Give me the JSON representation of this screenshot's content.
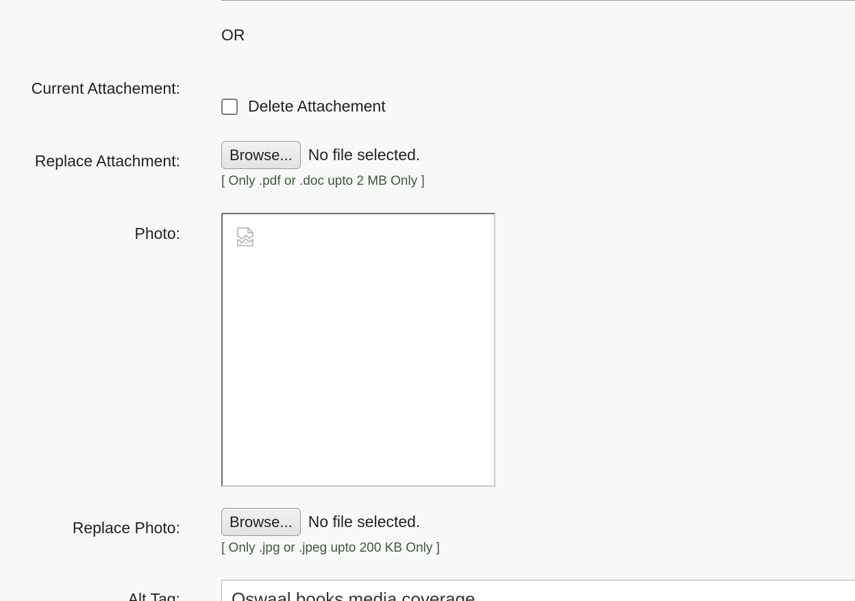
{
  "or_text": "OR",
  "current_attachment": {
    "label": "Current Attachement:",
    "delete_checkbox_label": "Delete Attachement",
    "delete_checked": false
  },
  "replace_attachment": {
    "label": "Replace Attachment:",
    "button_label": "Browse...",
    "file_status": "No file selected.",
    "hint": "[ Only .pdf or .doc upto 2 MB Only ]"
  },
  "photo": {
    "label": "Photo:",
    "preview_icon": "broken-image-icon"
  },
  "replace_photo": {
    "label": "Replace Photo:",
    "button_label": "Browse...",
    "file_status": "No file selected.",
    "hint": "[ Only .jpg or .jpeg upto 200 KB Only ]"
  },
  "alt_tag": {
    "label": "Alt Tag:",
    "value": "Oswaal books media coverage"
  }
}
